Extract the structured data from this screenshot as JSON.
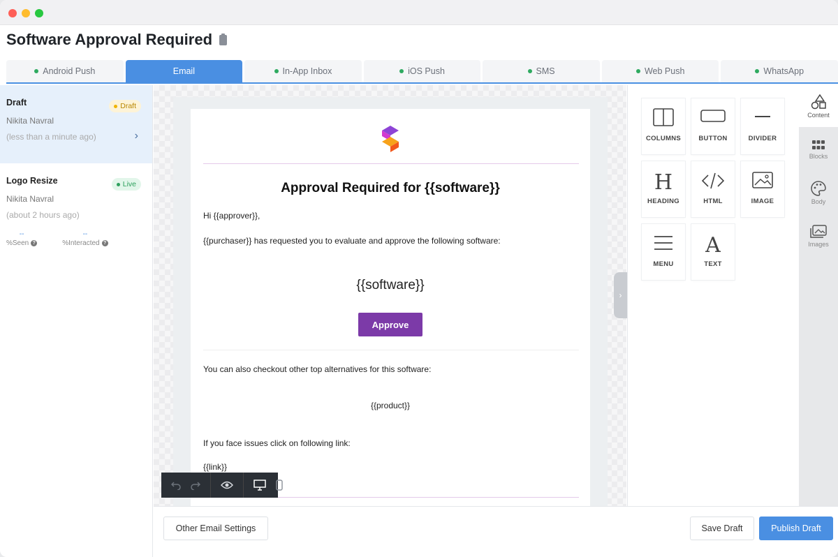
{
  "page": {
    "title": "Software Approval Required"
  },
  "tabs": [
    {
      "label": "Android Push",
      "active": false
    },
    {
      "label": "Email",
      "active": true
    },
    {
      "label": "In-App Inbox",
      "active": false
    },
    {
      "label": "iOS Push",
      "active": false
    },
    {
      "label": "SMS",
      "active": false
    },
    {
      "label": "Web Push",
      "active": false
    },
    {
      "label": "WhatsApp",
      "active": false
    }
  ],
  "versions": [
    {
      "name": "Draft",
      "badge": "Draft",
      "author": "Nikita Navral",
      "time": "(less than a minute ago)"
    },
    {
      "name": "Logo Resize",
      "badge": "Live",
      "author": "Nikita Navral",
      "time": "(about 2 hours ago)",
      "stats": [
        {
          "value": "--",
          "label": "%Seen"
        },
        {
          "value": "--",
          "label": "%Interacted"
        }
      ]
    }
  ],
  "email": {
    "heading": "Approval Required for {{software}}",
    "greeting": "Hi {{approver}},",
    "intro": "{{purchaser}} has requested you to evaluate and approve the following software:",
    "software": "{{software}}",
    "button": "Approve",
    "alternatives": "You can also checkout other top alternatives for this software:",
    "product": "{{product}}",
    "issues": "If you face issues click on following link:",
    "link": "{{link}}"
  },
  "tools": [
    {
      "label": "COLUMNS",
      "icon": "columns-icon"
    },
    {
      "label": "BUTTON",
      "icon": "button-icon"
    },
    {
      "label": "DIVIDER",
      "icon": "divider-icon"
    },
    {
      "label": "HEADING",
      "icon": "heading-icon"
    },
    {
      "label": "HTML",
      "icon": "code-icon"
    },
    {
      "label": "IMAGE",
      "icon": "image-icon"
    },
    {
      "label": "MENU",
      "icon": "menu-icon"
    },
    {
      "label": "TEXT",
      "icon": "text-icon"
    }
  ],
  "rail": [
    {
      "label": "Content",
      "active": true
    },
    {
      "label": "Blocks",
      "active": false
    },
    {
      "label": "Body",
      "active": false
    },
    {
      "label": "Images",
      "active": false
    }
  ],
  "footer": {
    "other_settings": "Other Email Settings",
    "save_draft": "Save Draft",
    "publish_draft": "Publish Draft"
  },
  "colors": {
    "accent": "#4a8fe2",
    "approve": "#7c3aa8",
    "live": "#2ea05d",
    "draft": "#f0b400"
  }
}
